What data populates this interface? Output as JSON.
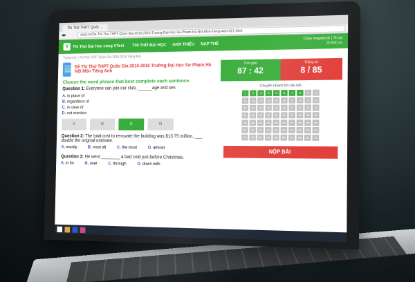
{
  "browser": {
    "tab_title": "Thi Thử THPT Quốc ...",
    "url": "vtest.vn/De-Thi-Thu-THPT-Quoc-Gia-2015-2016-Truong-Dai-Hoc-Su-Pham-Ha-Noi-Mon-Tieng-Anh-921.html"
  },
  "site_nav": {
    "logo_text": "Thi Thử Đại Học cùng VTest",
    "menu": [
      "THI THỬ ĐẠI HỌC",
      "GIỚI THIỆU",
      "NẠP THẺ"
    ],
    "user_line1": "Chào megabook | Thoát",
    "user_line2": "20.500 xu"
  },
  "breadcrumb": "Trang chủ  >  Thi Thử THPT Quốc Gia 2015-2016 Tiếng Anh",
  "exam_title": "Đề Thi Thử THPT Quốc Gia 2015-2016 Trường Đại Học Sư Phạm Hà Nội Môn Tiếng Anh",
  "instruction": "Choose the word phrase that best complete each sentence.",
  "questions": [
    {
      "label": "Question 1:",
      "text": "Everyone can join our club, ______age and sex.",
      "options": [
        {
          "letter": "A.",
          "text": "in place of"
        },
        {
          "letter": "B.",
          "text": "regardless of"
        },
        {
          "letter": "C.",
          "text": "in case of"
        },
        {
          "letter": "D.",
          "text": "not mention"
        }
      ],
      "answer_buttons": [
        "A",
        "B",
        "C",
        "D"
      ]
    },
    {
      "label": "Question 2:",
      "text": "The total cost to renovate the building was $13.75 million, ___ double the original estimate.",
      "options": [
        {
          "letter": "A.",
          "text": "mostly"
        },
        {
          "letter": "B.",
          "text": "most all"
        },
        {
          "letter": "C.",
          "text": "the most"
        },
        {
          "letter": "D.",
          "text": "almost"
        }
      ]
    },
    {
      "label": "Question 3:",
      "text": "He went ________ a bad cold just before Christmas.",
      "options": [
        {
          "letter": "A.",
          "text": "in for"
        },
        {
          "letter": "B.",
          "text": "over"
        },
        {
          "letter": "C.",
          "text": "through"
        },
        {
          "letter": "D.",
          "text": "down with"
        }
      ]
    }
  ],
  "timer": {
    "label": "Thời gian",
    "value": "87 : 42"
  },
  "progress": {
    "label": "Thống kê",
    "value": "8 / 85"
  },
  "question_nav_title": "Chuyển nhanh tới câu hỏi",
  "question_numbers": [
    "1",
    "2",
    "3",
    "4",
    "5",
    "6",
    "7",
    "8",
    "9",
    "10",
    "11",
    "12",
    "13",
    "14",
    "15",
    "16",
    "17",
    "18",
    "19",
    "20",
    "21",
    "22",
    "23",
    "24",
    "25",
    "26",
    "27",
    "28",
    "29",
    "30",
    "31",
    "32",
    "33",
    "34",
    "35",
    "36",
    "37",
    "38",
    "39",
    "40",
    "41",
    "42",
    "43",
    "44",
    "45",
    "46",
    "47",
    "48",
    "49",
    "50",
    "51",
    "52",
    "53",
    "54",
    "55",
    "56",
    "57",
    "58",
    "59",
    "60",
    "61",
    "62",
    "63",
    "64",
    "65",
    "66",
    "67",
    "68",
    "69",
    "70"
  ],
  "answered": [
    1,
    2,
    3,
    4,
    5,
    6,
    7,
    8
  ],
  "submit_label": "NỘP BÀI",
  "colors": {
    "brand_green": "#3aae3c",
    "accent_red": "#e2403b",
    "option_blue": "#2a57c9"
  }
}
